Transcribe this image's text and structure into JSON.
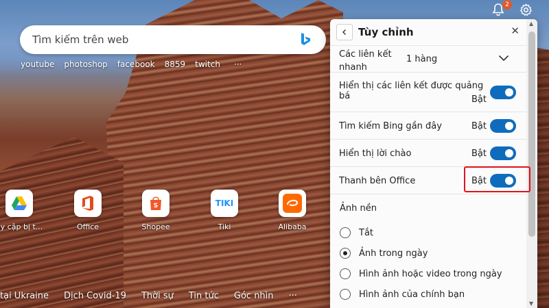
{
  "search": {
    "placeholder": "Tìm kiếm trên web"
  },
  "quicklinks": [
    "youtube",
    "photoshop",
    "facebook",
    "8859",
    "twitch",
    "···"
  ],
  "notifications": {
    "count": "2"
  },
  "tiles": [
    {
      "label": "uy cập bị t...",
      "icon": "google-drive-icon"
    },
    {
      "label": "Office",
      "icon": "office-icon"
    },
    {
      "label": "Shopee",
      "icon": "shopee-icon"
    },
    {
      "label": "Tiki",
      "icon": "tiki-icon",
      "text": "TIKI"
    },
    {
      "label": "Alibaba",
      "icon": "alibaba-icon"
    }
  ],
  "bottom_nav": [
    "tại Ukraine",
    "Dịch Covid-19",
    "Thời sự",
    "Tin tức",
    "Góc nhìn",
    "···"
  ],
  "panel": {
    "title": "Tùy chỉnh",
    "quicklinks_row": {
      "label": "Các liên kết nhanh",
      "value": "1 hàng"
    },
    "rows": [
      {
        "label": "Hiển thị các liên kết được quảng bá",
        "state": "Bật"
      },
      {
        "label": "Tìm kiếm Bing gần đây",
        "state": "Bật"
      },
      {
        "label": "Hiển thị lời chào",
        "state": "Bật"
      },
      {
        "label": "Thanh bên Office",
        "state": "Bật"
      }
    ],
    "background_section": "Ảnh nền",
    "background_options": [
      {
        "label": "Tắt",
        "checked": false
      },
      {
        "label": "Ảnh trong ngày",
        "checked": true
      },
      {
        "label": "Hình ảnh hoặc video trong ngày",
        "checked": false
      },
      {
        "label": "Hình ảnh của chính bạn",
        "checked": false
      }
    ]
  },
  "colors": {
    "toggle_on": "#0f6cbd",
    "highlight": "#e0121a"
  }
}
